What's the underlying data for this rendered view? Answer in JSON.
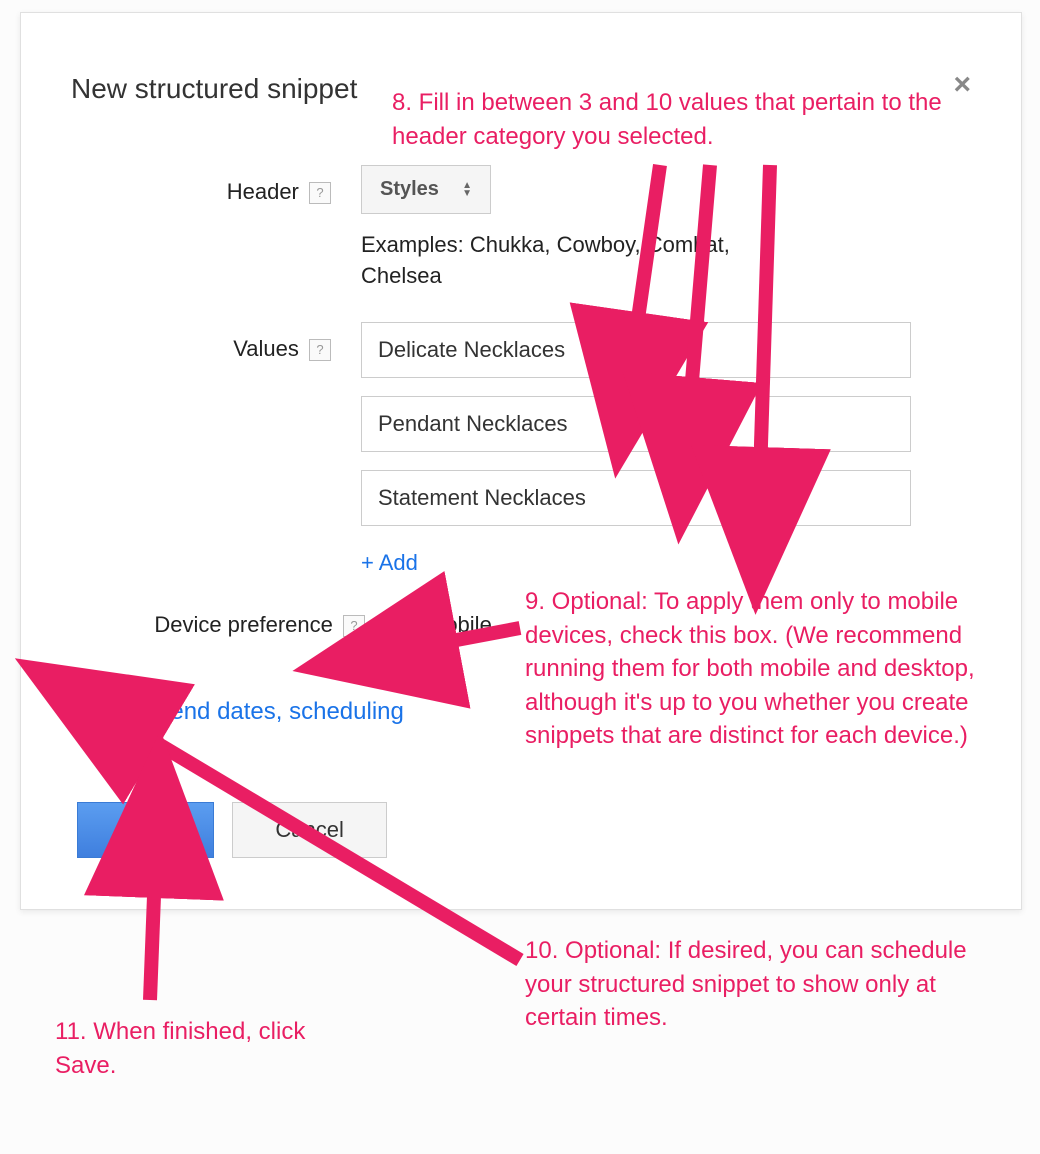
{
  "dialog": {
    "title": "New structured snippet",
    "close_label": "×"
  },
  "header": {
    "label": "Header",
    "select_value": "Styles",
    "examples": "Examples: Chukka, Cowboy, Combat, Chelsea"
  },
  "values": {
    "label": "Values",
    "items": [
      "Delicate Necklaces",
      "Pendant Necklaces",
      "Statement Necklaces"
    ],
    "add_label": "+ Add"
  },
  "device": {
    "label": "Device preference",
    "checkbox_label": "Mobile",
    "checked": false
  },
  "schedule": {
    "expand_icon": "+",
    "label": "Start/end dates, scheduling"
  },
  "buttons": {
    "save": "Save",
    "cancel": "Cancel"
  },
  "annotations": {
    "step8": "8. Fill in between 3 and 10 values that pertain to the header category you selected.",
    "step9": "9. Optional: To apply them only to mobile devices, check this box. (We recommend running them for both mobile and desktop, although it's up to you whether you create snippets that are distinct for each device.)",
    "step10": "10. Optional: If desired, you can schedule your structured snippet to show only at certain times.",
    "step11": "11. When finished, click Save."
  },
  "colors": {
    "annotation": "#e91e63",
    "link": "#1a73e8",
    "primary_button": "#4a90e2"
  }
}
